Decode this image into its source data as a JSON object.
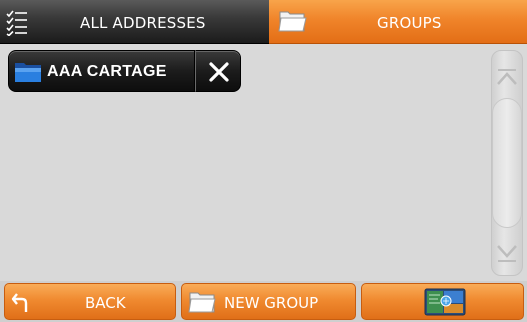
{
  "tabs": {
    "all_addresses": "ALL ADDRESSES",
    "groups": "GROUPS",
    "active": "groups"
  },
  "groups_list": [
    {
      "name": "AAA CARTAGE",
      "icon": "folder-icon",
      "remove_icon": "close-icon"
    }
  ],
  "bottom_bar": {
    "back_label": "BACK",
    "new_group_label": "NEW GROUP",
    "map_icon": "map-icon"
  },
  "colors": {
    "accent_orange": "#f08a30",
    "dark_tab": "#2a2a2a",
    "background": "#d9d9d9",
    "folder_blue": "#1f6fd0"
  }
}
